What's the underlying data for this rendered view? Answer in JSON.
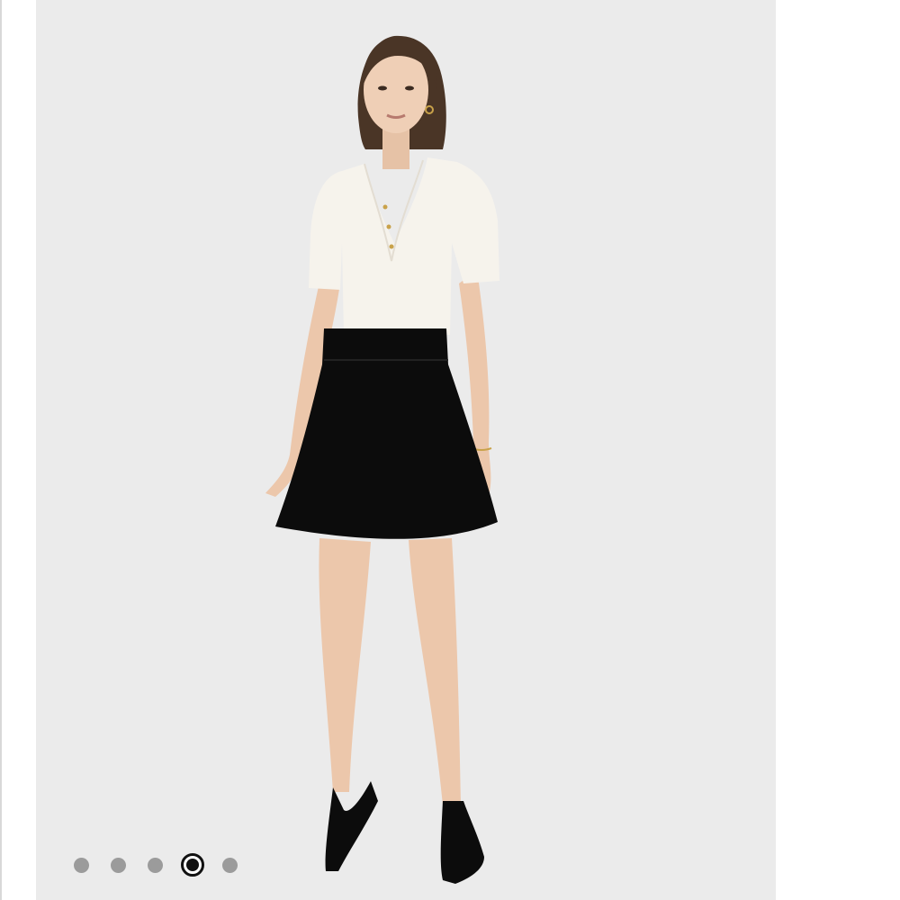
{
  "gallery": {
    "image": "product-photo-model-white-henley-top-black-skater-skirt",
    "slide_count": 5,
    "active_slide_index": 3,
    "colors": {
      "background": "#ebebeb",
      "dot_inactive": "#9b9b9b",
      "dot_active": "#111111"
    }
  }
}
